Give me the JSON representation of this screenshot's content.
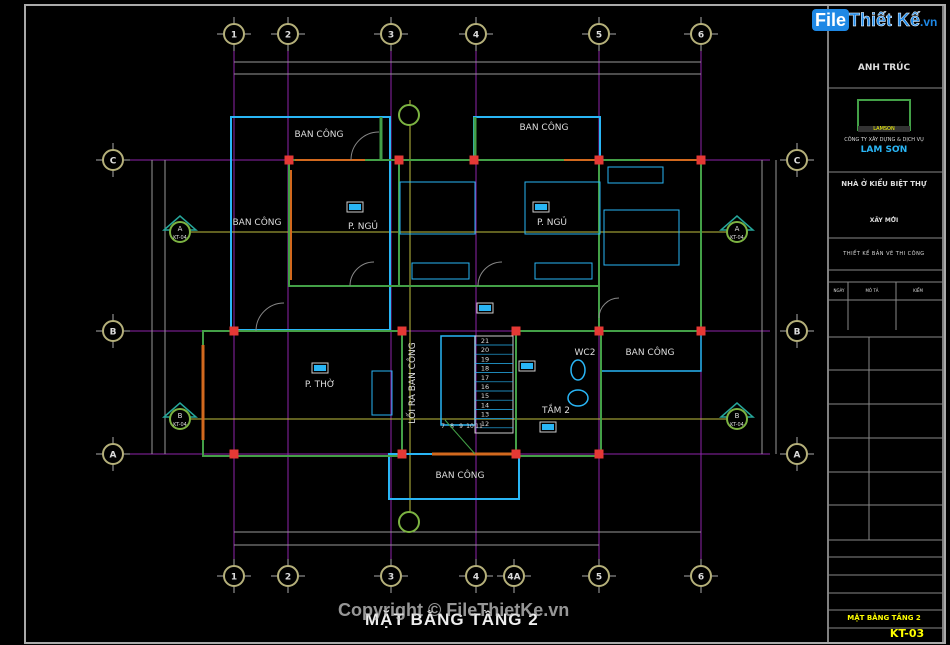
{
  "drawing": {
    "title": "MẶT BẰNG TẦNG 2",
    "watermark_bottom": "Copyright © FileThietKe.vn",
    "watermark_logo": {
      "file": "File",
      "rest": "Thiết Kế",
      "suffix": ".vn"
    }
  },
  "grid": {
    "columns": [
      "1",
      "2",
      "3",
      "4",
      "5",
      "6"
    ],
    "bottom_columns": [
      "1",
      "2",
      "3",
      "4",
      "4A",
      "5",
      "6"
    ],
    "rows": [
      "C",
      "B",
      "A"
    ]
  },
  "rooms": [
    {
      "name": "BAN CÔNG",
      "key": "balcony-top-left"
    },
    {
      "name": "BAN CÔNG",
      "key": "balcony-top-right"
    },
    {
      "name": "BAN CÔNG",
      "key": "balcony-left"
    },
    {
      "name": "P. NGỦ",
      "key": "bedroom-1"
    },
    {
      "name": "P. NGỦ",
      "key": "bedroom-2"
    },
    {
      "name": "P. THỜ",
      "key": "worship-room"
    },
    {
      "name": "WC2",
      "key": "wc2"
    },
    {
      "name": "TẮM 2",
      "key": "bath-2"
    },
    {
      "name": "BAN CÔNG",
      "key": "balcony-right"
    },
    {
      "name": "BAN CÔNG",
      "key": "balcony-bottom"
    },
    {
      "name": "LỐI RA BAN CÔNG",
      "key": "balcony-exit"
    }
  ],
  "stairs": {
    "steps": [
      "21",
      "20",
      "19",
      "18",
      "17",
      "16",
      "15",
      "14",
      "13",
      "12"
    ],
    "bottom_steps": [
      "7",
      "8",
      "9",
      "10",
      "11"
    ]
  },
  "section_markers": [
    {
      "label": "A",
      "sheet": "KT-04",
      "side": "left"
    },
    {
      "label": "B",
      "sheet": "KT-04",
      "side": "left"
    },
    {
      "label": "A",
      "sheet": "KT-04",
      "side": "right"
    },
    {
      "label": "B",
      "sheet": "KT-04",
      "side": "right"
    }
  ],
  "title_block": {
    "firm_top": "ANH TRÚC",
    "company_logo_text": "LAMSON",
    "company_line": "CÔNG TY XÂY DỰNG & DỊCH VỤ",
    "company_name": "LAM SƠN",
    "project": "NHÀ Ở KIỂU BIỆT THỰ",
    "category": "XÂY MỚI",
    "phase": "THIẾT KẾ BẢN VẼ THI CÔNG",
    "revision_headers": [
      "NGÀY",
      "MÔ TẢ",
      "KIỂM"
    ],
    "sheet_title": "MẶT BẰNG TẦNG 2",
    "sheet_number": "KT-03"
  }
}
